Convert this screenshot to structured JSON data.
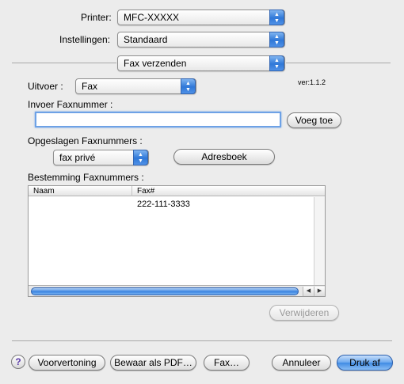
{
  "printer": {
    "label": "Printer:",
    "value": "MFC-XXXXX"
  },
  "settings": {
    "label": "Instellingen:",
    "value": "Standaard"
  },
  "panel": {
    "value": "Fax verzenden"
  },
  "output": {
    "label": "Uitvoer :",
    "value": "Fax",
    "version": "ver:1.1.2"
  },
  "fax_input": {
    "label": "Invoer Faxnummer :",
    "value": "",
    "add_button": "Voeg toe"
  },
  "saved": {
    "label": "Opgeslagen Faxnummers :",
    "value": "fax privé",
    "addressbook_button": "Adresboek"
  },
  "destination": {
    "label": "Bestemming Faxnummers :",
    "columns": [
      "Naam",
      "Fax#"
    ],
    "rows": [
      {
        "name": "",
        "fax": "222-111-3333"
      }
    ],
    "remove_button": "Verwijderen"
  },
  "footer": {
    "help": "?",
    "preview": "Voorvertoning",
    "save_pdf": "Bewaar als PDF…",
    "fax": "Fax…",
    "cancel": "Annuleer",
    "print": "Druk af"
  }
}
